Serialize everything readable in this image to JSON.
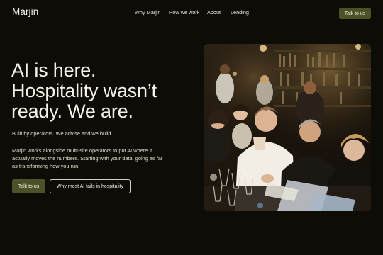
{
  "nav": {
    "logo": "Marjin",
    "links": [
      "Why Marjin",
      "How we work",
      "About",
      "Lending"
    ],
    "cta": "Talk to us"
  },
  "hero": {
    "headline": [
      "AI is here.",
      "Hospitality wasn’t",
      "ready. We are."
    ],
    "subheadline": "Built by operators. We advise and we build.",
    "body": "Marjin works alongside multi-site operators to put AI where it actually moves the numbers. Starting with your data, going as far as transforming how you run.",
    "primary_button": "Talk to us",
    "secondary_button": "Why most AI fails in hospitality"
  },
  "colors": {
    "background": "#0e0c06",
    "button_olive": "#4c5128",
    "text": "#f3efe4"
  },
  "image": {
    "subject": "restaurant-bar-team-photo"
  }
}
